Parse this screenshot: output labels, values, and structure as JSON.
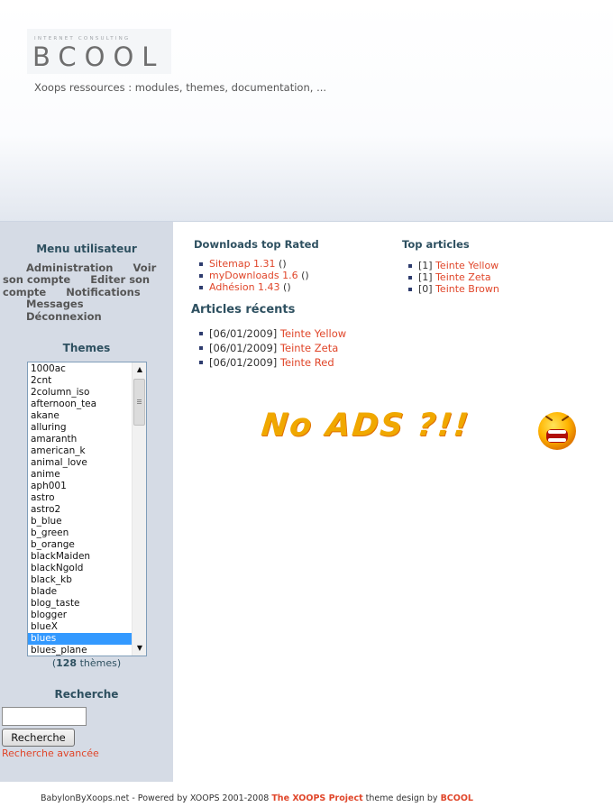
{
  "header": {
    "logo_small": "INTERNET CONSULTING",
    "logo_main": "BCOOL",
    "slogan": "Xoops ressources : modules, themes, documentation, ..."
  },
  "user_menu": {
    "title": "Menu utilisateur",
    "items": [
      "Administration",
      "Voir son compte",
      "Editer son compte",
      "Notifications",
      "Messages",
      "Déconnexion"
    ]
  },
  "themes": {
    "title": "Themes",
    "list": [
      "1000ac",
      "2cnt",
      "2column_iso",
      "afternoon_tea",
      "akane",
      "alluring",
      "amaranth",
      "american_k",
      "animal_love",
      "anime",
      "aph001",
      "astro",
      "astro2",
      "b_blue",
      "b_green",
      "b_orange",
      "blackMaiden",
      "blackNgold",
      "black_kb",
      "blade",
      "blog_taste",
      "blogger",
      "blueX",
      "blues",
      "blues_plane"
    ],
    "selected": "blues",
    "count": "128",
    "count_label": "thèmes",
    "count_open": "(",
    "count_close": ")"
  },
  "search": {
    "title": "Recherche",
    "input_value": "",
    "button_label": "Recherche",
    "advanced_link": "Recherche avancée"
  },
  "downloads": {
    "title": "Downloads top Rated",
    "items": [
      {
        "name": "Sitemap 1.31",
        "suffix": " ()"
      },
      {
        "name": "myDownloads 1.6",
        "suffix": " ()"
      },
      {
        "name": "Adhésion 1.43",
        "suffix": " ()"
      }
    ]
  },
  "top_articles": {
    "title": "Top articles",
    "items": [
      {
        "count": "[1] ",
        "name": "Teinte Yellow"
      },
      {
        "count": "[1] ",
        "name": "Teinte Zeta"
      },
      {
        "count": "[0] ",
        "name": "Teinte Brown"
      }
    ]
  },
  "recent_articles": {
    "title": "Articles récents",
    "items": [
      {
        "date": "[06/01/2009] ",
        "name": "Teinte Yellow"
      },
      {
        "date": "[06/01/2009] ",
        "name": "Teinte Zeta"
      },
      {
        "date": "[06/01/2009] ",
        "name": "Teinte Red"
      }
    ]
  },
  "banner": {
    "text": "No ADS ?!!"
  },
  "footer": {
    "prefix": "BabylonByXoops.net - Powered by XOOPS 2001-2008 ",
    "project": "The XOOPS Project",
    "middle": " theme design by ",
    "designer": "BCOOL"
  },
  "colors": {
    "link": "#e0462a",
    "title": "#2e5060",
    "sidebar_bg": "#d5dbe5",
    "selected": "#3399ff"
  }
}
